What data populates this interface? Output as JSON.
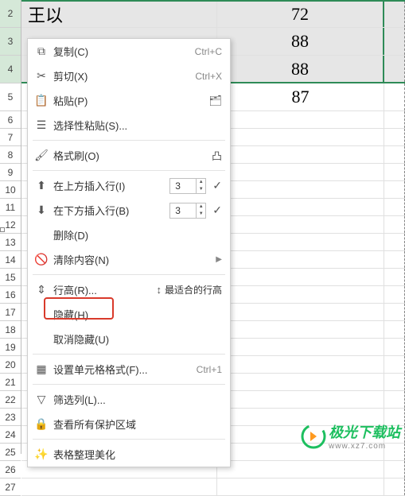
{
  "rows": {
    "r2": {
      "num": "2",
      "a": "王以",
      "b": "72"
    },
    "r3": {
      "num": "3",
      "a": "",
      "b": "88"
    },
    "r4": {
      "num": "4",
      "a": "",
      "b": "88"
    },
    "r5": {
      "num": "5",
      "a": "",
      "b": "87"
    },
    "nums": [
      "6",
      "7",
      "8",
      "9",
      "10",
      "11",
      "12",
      "13",
      "14",
      "15",
      "16",
      "17",
      "18",
      "19",
      "20",
      "21",
      "22",
      "23",
      "24",
      "25",
      "26",
      "27"
    ]
  },
  "menu": {
    "copy": "复制(C)",
    "copy_sc": "Ctrl+C",
    "cut": "剪切(X)",
    "cut_sc": "Ctrl+X",
    "paste": "粘贴(P)",
    "paste_special": "选择性粘贴(S)...",
    "format_painter": "格式刷(O)",
    "insert_above": "在上方插入行(I)",
    "insert_below": "在下方插入行(B)",
    "insert_count": "3",
    "delete": "删除(D)",
    "clear": "清除内容(N)",
    "row_height": "行高(R)...",
    "best_fit": "最适合的行高",
    "hide": "隐藏(H)",
    "unhide": "取消隐藏(U)",
    "cell_format": "设置单元格格式(F)...",
    "cell_format_sc": "Ctrl+1",
    "filter": "筛选列(L)...",
    "protect": "查看所有保护区域",
    "beautify": "表格整理美化"
  },
  "watermark": {
    "line1": "极光下载站",
    "line2": "www.xz7.com"
  }
}
